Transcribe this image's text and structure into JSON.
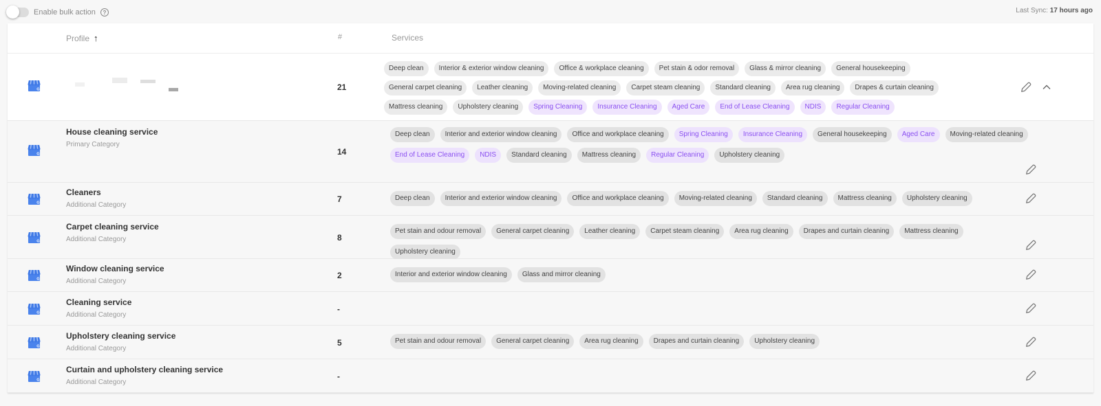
{
  "topbar": {
    "bulk_label": "Enable bulk action",
    "bulk_enabled": false,
    "help_glyph": "?",
    "sync_label": "Last Sync:",
    "sync_value": "17 hours ago"
  },
  "table": {
    "headers": {
      "profile": "Profile",
      "sort_glyph": "↑",
      "count": "#",
      "services": "Services"
    },
    "rows": [
      {
        "name": "",
        "category": "",
        "count": "21",
        "expanded": true,
        "services": [
          {
            "label": "Deep clean",
            "custom": false
          },
          {
            "label": "Interior & exterior window cleaning",
            "custom": false
          },
          {
            "label": "Office & workplace cleaning",
            "custom": false
          },
          {
            "label": "Pet stain & odor removal",
            "custom": false
          },
          {
            "label": "Glass & mirror cleaning",
            "custom": false
          },
          {
            "label": "General housekeeping",
            "custom": false
          },
          {
            "label": "General carpet cleaning",
            "custom": false
          },
          {
            "label": "Leather cleaning",
            "custom": false
          },
          {
            "label": "Moving-related cleaning",
            "custom": false
          },
          {
            "label": "Carpet steam cleaning",
            "custom": false
          },
          {
            "label": "Standard cleaning",
            "custom": false
          },
          {
            "label": "Area rug cleaning",
            "custom": false
          },
          {
            "label": "Drapes & curtain cleaning",
            "custom": false
          },
          {
            "label": "Mattress cleaning",
            "custom": false
          },
          {
            "label": "Upholstery cleaning",
            "custom": false
          },
          {
            "label": "Spring Cleaning",
            "custom": true
          },
          {
            "label": "Insurance Cleaning",
            "custom": true
          },
          {
            "label": "Aged Care",
            "custom": true
          },
          {
            "label": "End of Lease Cleaning",
            "custom": true
          },
          {
            "label": "NDIS",
            "custom": true
          },
          {
            "label": "Regular Cleaning",
            "custom": true
          }
        ]
      },
      {
        "name": "House cleaning service",
        "category": "Primary Category",
        "count": "14",
        "services": [
          {
            "label": "Deep clean",
            "custom": false
          },
          {
            "label": "Interior and exterior window cleaning",
            "custom": false
          },
          {
            "label": "Office and workplace cleaning",
            "custom": false
          },
          {
            "label": "Spring Cleaning",
            "custom": true
          },
          {
            "label": "Insurance Cleaning",
            "custom": true
          },
          {
            "label": "General housekeeping",
            "custom": false
          },
          {
            "label": "Aged Care",
            "custom": true
          },
          {
            "label": "Moving-related cleaning",
            "custom": false
          },
          {
            "label": "End of Lease Cleaning",
            "custom": true
          },
          {
            "label": "NDIS",
            "custom": true
          },
          {
            "label": "Standard cleaning",
            "custom": false
          },
          {
            "label": "Mattress cleaning",
            "custom": false
          },
          {
            "label": "Regular Cleaning",
            "custom": true
          },
          {
            "label": "Upholstery cleaning",
            "custom": false
          }
        ]
      },
      {
        "name": "Cleaners",
        "category": "Additional Category",
        "count": "7",
        "services": [
          {
            "label": "Deep clean",
            "custom": false
          },
          {
            "label": "Interior and exterior window cleaning",
            "custom": false
          },
          {
            "label": "Office and workplace cleaning",
            "custom": false
          },
          {
            "label": "Moving-related cleaning",
            "custom": false
          },
          {
            "label": "Standard cleaning",
            "custom": false
          },
          {
            "label": "Mattress cleaning",
            "custom": false
          },
          {
            "label": "Upholstery cleaning",
            "custom": false
          }
        ]
      },
      {
        "name": "Carpet cleaning service",
        "category": "Additional Category",
        "count": "8",
        "services": [
          {
            "label": "Pet stain and odour removal",
            "custom": false
          },
          {
            "label": "General carpet cleaning",
            "custom": false
          },
          {
            "label": "Leather cleaning",
            "custom": false
          },
          {
            "label": "Carpet steam cleaning",
            "custom": false
          },
          {
            "label": "Area rug cleaning",
            "custom": false
          },
          {
            "label": "Drapes and curtain cleaning",
            "custom": false
          },
          {
            "label": "Mattress cleaning",
            "custom": false
          },
          {
            "label": "Upholstery cleaning",
            "custom": false
          }
        ]
      },
      {
        "name": "Window cleaning service",
        "category": "Additional Category",
        "count": "2",
        "services": [
          {
            "label": "Interior and exterior window cleaning",
            "custom": false
          },
          {
            "label": "Glass and mirror cleaning",
            "custom": false
          }
        ]
      },
      {
        "name": "Cleaning service",
        "category": "Additional Category",
        "count": "-",
        "services": []
      },
      {
        "name": "Upholstery cleaning service",
        "category": "Additional Category",
        "count": "5",
        "services": [
          {
            "label": "Pet stain and odour removal",
            "custom": false
          },
          {
            "label": "General carpet cleaning",
            "custom": false
          },
          {
            "label": "Area rug cleaning",
            "custom": false
          },
          {
            "label": "Drapes and curtain cleaning",
            "custom": false
          },
          {
            "label": "Upholstery cleaning",
            "custom": false
          }
        ]
      },
      {
        "name": "Curtain and upholstery cleaning service",
        "category": "Additional Category",
        "count": "-",
        "services": []
      }
    ]
  },
  "colors": {
    "custom_chip_bg": "#ede2fd",
    "custom_chip_text": "#8a4ff0",
    "chip_bg": "#e2e2e2",
    "store_icon": "#4285f4"
  }
}
